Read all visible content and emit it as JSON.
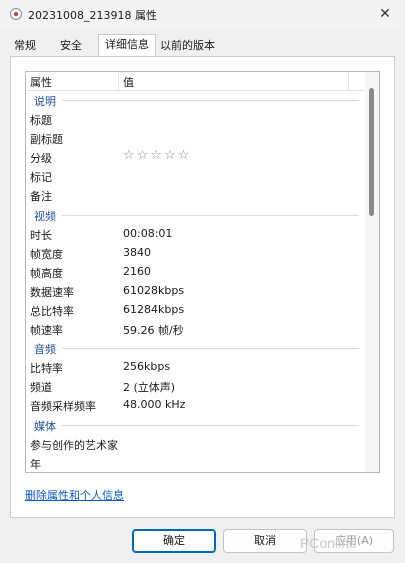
{
  "window": {
    "title": "20231008_213918 属性",
    "close_glyph": "✕"
  },
  "tabs": [
    {
      "label": "常规"
    },
    {
      "label": "安全"
    },
    {
      "label": "详细信息",
      "active": true
    },
    {
      "label": "以前的版本"
    }
  ],
  "list": {
    "columns": [
      "属性",
      "值"
    ],
    "groups": {
      "description": "说明",
      "video": "视频",
      "audio": "音频",
      "media": "媒体"
    },
    "rows": {
      "title": {
        "k": "标题",
        "v": ""
      },
      "subtitle": {
        "k": "副标题",
        "v": ""
      },
      "rating": {
        "k": "分级",
        "stars": "☆☆☆☆☆",
        "value": 0
      },
      "tags": {
        "k": "标记",
        "v": ""
      },
      "comments": {
        "k": "备注",
        "v": ""
      },
      "duration": {
        "k": "时长",
        "v": "00:08:01"
      },
      "frame_width": {
        "k": "帧宽度",
        "v": "3840"
      },
      "frame_height": {
        "k": "帧高度",
        "v": "2160"
      },
      "data_rate": {
        "k": "数据速率",
        "v": "61028kbps"
      },
      "total_bitrate": {
        "k": "总比特率",
        "v": "61284kbps"
      },
      "frame_rate": {
        "k": "帧速率",
        "v": "59.26 帧/秒"
      },
      "bitrate": {
        "k": "比特率",
        "v": "256kbps"
      },
      "channels": {
        "k": "频道",
        "v": "2 (立体声)"
      },
      "sample_rate": {
        "k": "音频采样频率",
        "v": "48.000 kHz"
      },
      "contributing_artists": {
        "k": "参与创作的艺术家",
        "v": ""
      },
      "year": {
        "k": "年",
        "v": ""
      }
    }
  },
  "remove_link": "删除属性和个人信息",
  "buttons": {
    "ok": "确定",
    "cancel": "取消",
    "apply": "应用(A)"
  },
  "watermark": "PConline",
  "colors": {
    "group_header": "#1f4e9c",
    "link": "#0b57d0",
    "primary_border": "#0067c0"
  }
}
